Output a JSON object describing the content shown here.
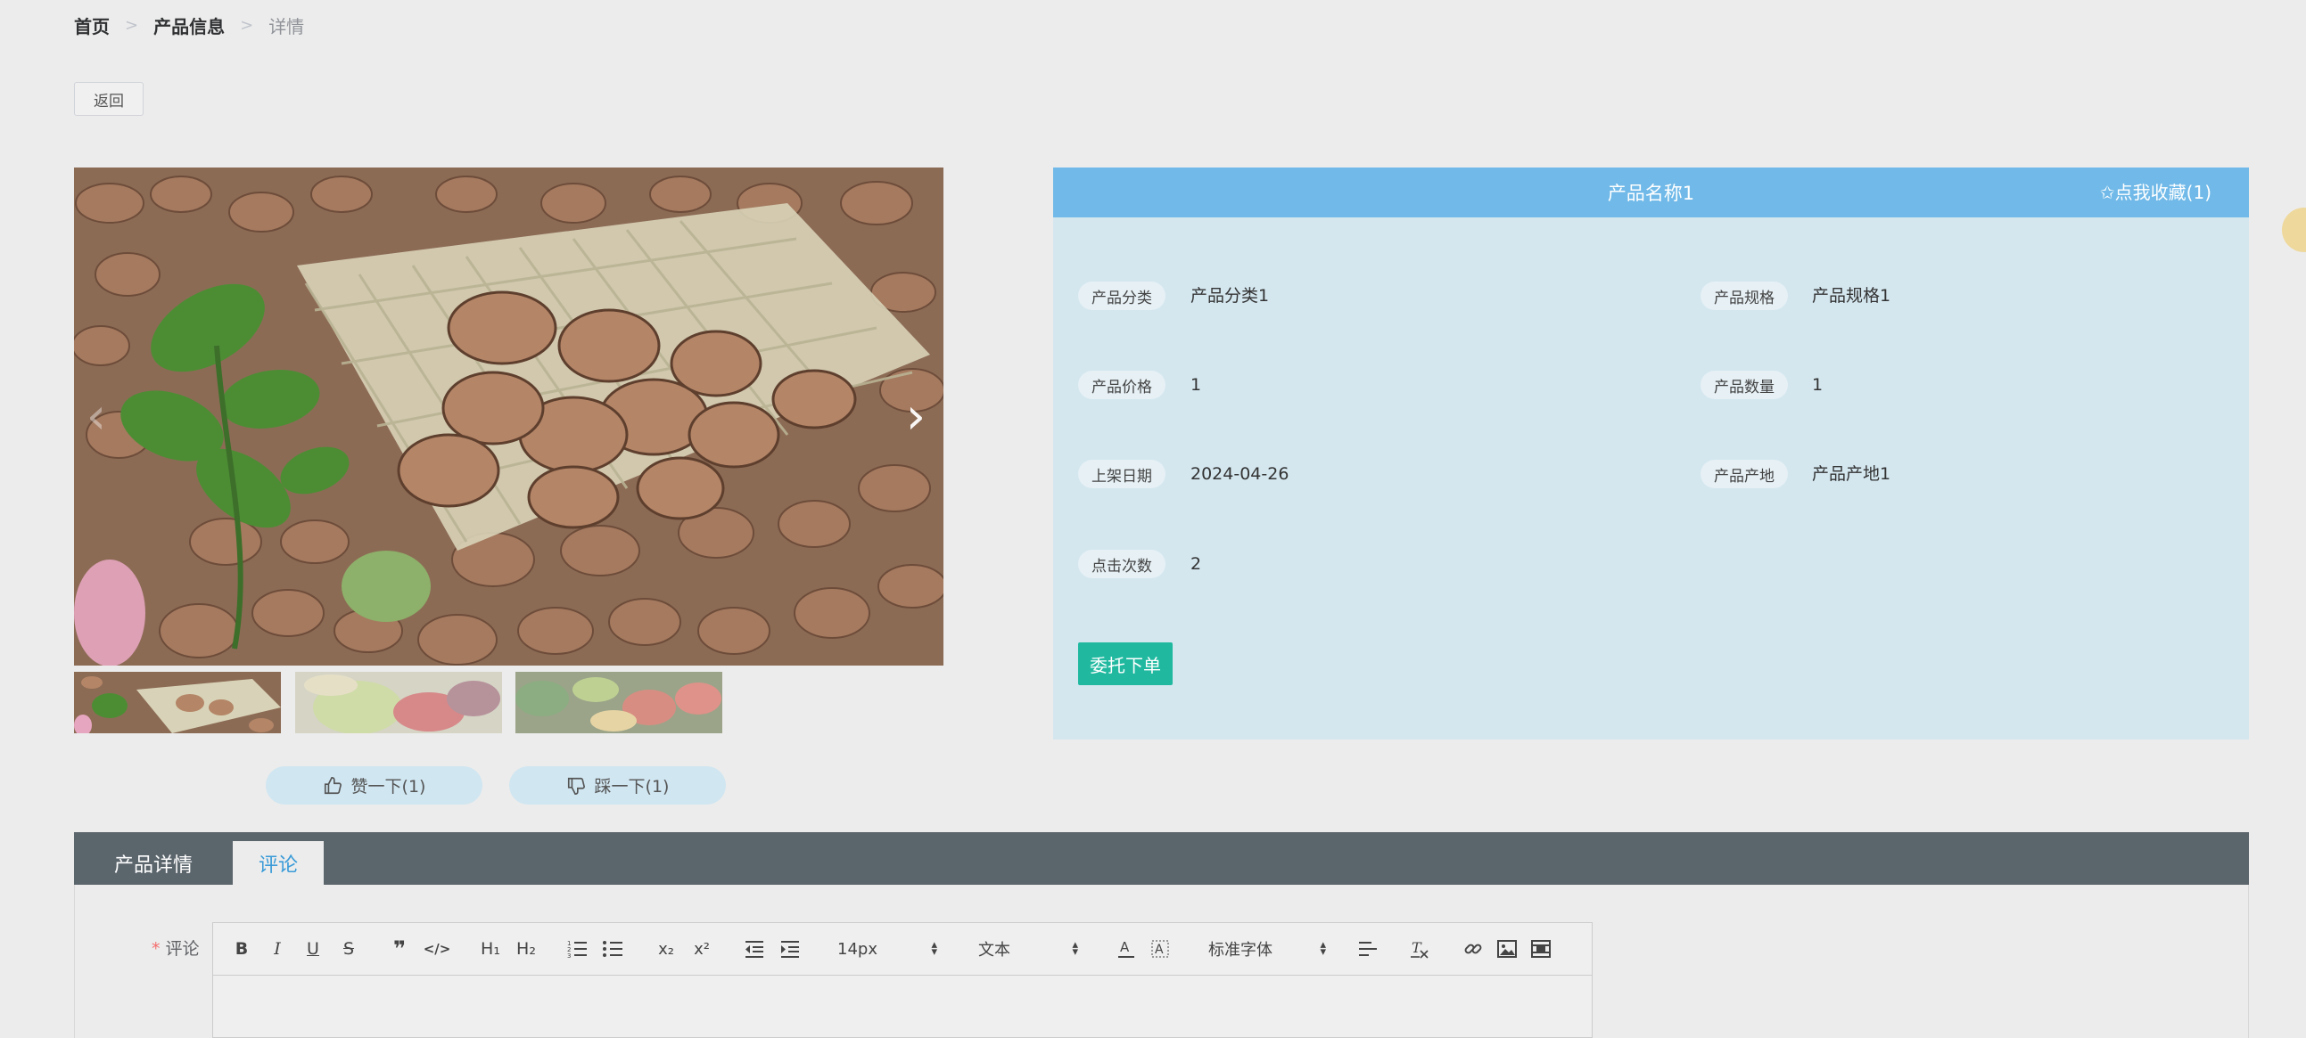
{
  "breadcrumb": {
    "home": "首页",
    "separator": ">",
    "section": "产品信息",
    "current": "详情"
  },
  "back_button": "返回",
  "carousel": {
    "prev_icon": "chevron-left-icon",
    "next_icon": "chevron-right-icon",
    "thumbnails": 3,
    "active_index": 0
  },
  "votes": {
    "like_label": "赞一下(1)",
    "dislike_label": "踩一下(1)"
  },
  "product": {
    "name": "产品名称1",
    "favorite_label": "✩点我收藏(1)",
    "fields": [
      {
        "label": "产品分类",
        "value": "产品分类1"
      },
      {
        "label": "产品规格",
        "value": "产品规格1"
      },
      {
        "label": "产品价格",
        "value": "1"
      },
      {
        "label": "产品数量",
        "value": "1"
      },
      {
        "label": "上架日期",
        "value": "2024-04-26"
      },
      {
        "label": "产品产地",
        "value": "产品产地1"
      },
      {
        "label": "点击次数",
        "value": "2"
      }
    ],
    "order_button": "委托下单"
  },
  "tabs": [
    {
      "label": "产品详情",
      "active": false
    },
    {
      "label": "评论",
      "active": true
    }
  ],
  "comment": {
    "required_mark": "*",
    "label": "评论",
    "toolbar": {
      "bold": "B",
      "italic": "I",
      "underline": "U",
      "strike": "S",
      "blockquote": "❞",
      "code": "</>",
      "h1": "H₁",
      "h2": "H₂",
      "subscript": "x₂",
      "superscript": "x²",
      "font_size": "14px",
      "header": "文本",
      "font_family": "标准字体"
    }
  },
  "colors": {
    "header_blue": "#70b9e8",
    "panel_bg": "#d4e7ef",
    "order_green": "#20b9a0",
    "tab_bar": "#5b656c",
    "tab_active_text": "#3a9bd8"
  }
}
